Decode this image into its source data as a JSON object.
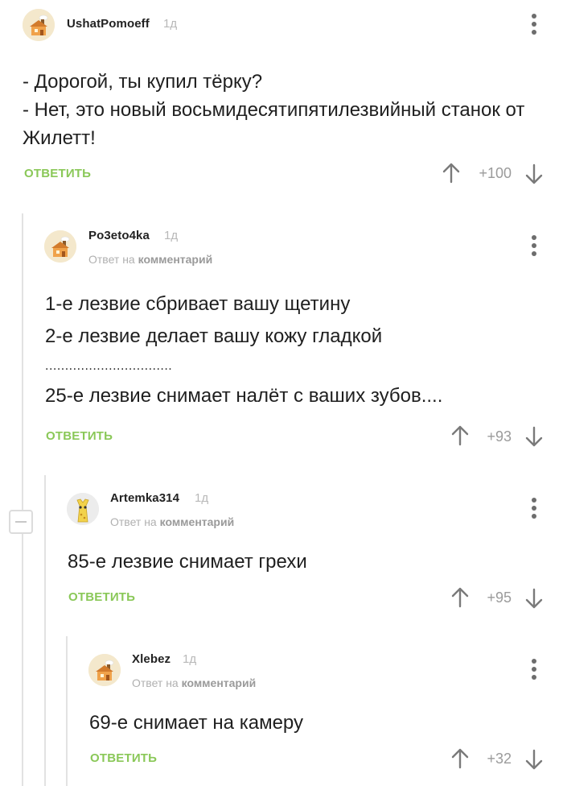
{
  "comments": [
    {
      "username": "UshatPomoeff",
      "age": "1д",
      "lines": [
        "- Дорогой, ты купил тёрку?",
        "- Нет, это новый восьмидесятипятилезвийный станок от",
        "Жилетт!"
      ],
      "reply_label": "ОТВЕТИТЬ",
      "score": "+100"
    },
    {
      "username": "Po3eto4ka",
      "age": "1д",
      "reply_prefix": "Ответ на",
      "reply_target": "комментарий",
      "lines": [
        "1-е лезвие сбривает вашу щетину",
        "2-е лезвие делает вашу кожу гладкой",
        "................................",
        "25-е лезвие снимает налёт с ваших зубов...."
      ],
      "reply_label": "ОТВЕТИТЬ",
      "score": "+93"
    },
    {
      "username": "Artemka314",
      "age": "1д",
      "reply_prefix": "Ответ на",
      "reply_target": "комментарий",
      "lines": [
        "85-е лезвие снимает грехи"
      ],
      "reply_label": "ОТВЕТИТЬ",
      "score": "+95"
    },
    {
      "username": "Xlebez",
      "age": "1д",
      "reply_prefix": "Ответ на",
      "reply_target": "комментарий",
      "lines": [
        "69-е снимает на камеру"
      ],
      "reply_label": "ОТВЕТИТЬ",
      "score": "+32"
    }
  ],
  "colors": {
    "accent_green": "#8ac858",
    "muted_gray": "#b0b0b0",
    "thread_line": "#e2e2e2"
  },
  "icons": {
    "vote_up": "arrow-up-icon",
    "vote_down": "arrow-down-icon",
    "menu": "kebab-menu-icon",
    "collapse": "collapse-minus-icon"
  }
}
